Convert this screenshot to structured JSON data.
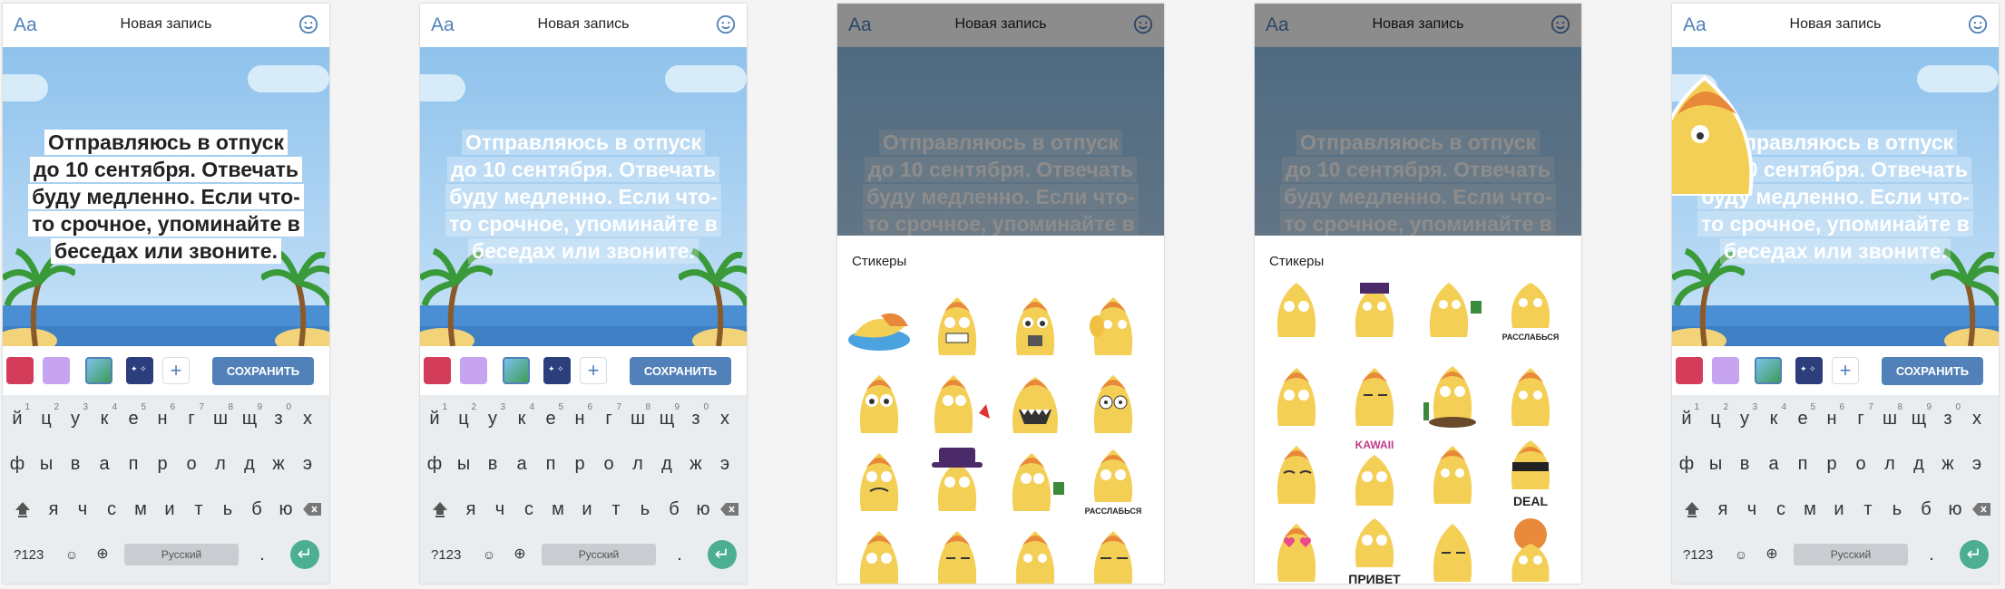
{
  "header": {
    "aa": "Aa",
    "title": "Новая запись"
  },
  "message": {
    "lines": [
      "Отправляюсь в отпуск",
      "до 10 сентября. Отвечать",
      "буду медленно. Если что-",
      "то срочное, упоминайте в",
      "беседах или звоните."
    ]
  },
  "toolbar": {
    "save_label": "СОХРАНИТЬ",
    "plus_label": "+"
  },
  "keyboard": {
    "row1": [
      "й",
      "ц",
      "у",
      "к",
      "е",
      "н",
      "г",
      "ш",
      "щ",
      "з",
      "х"
    ],
    "row1_hints": [
      "1",
      "2",
      "3",
      "4",
      "5",
      "6",
      "7",
      "8",
      "9",
      "0",
      ""
    ],
    "row2": [
      "ф",
      "ы",
      "в",
      "а",
      "п",
      "р",
      "о",
      "л",
      "д",
      "ж",
      "э"
    ],
    "row3": [
      "я",
      "ч",
      "с",
      "м",
      "и",
      "т",
      "ь",
      "б",
      "ю"
    ],
    "num_label": "?123",
    "space_label": "Русский",
    "period": "."
  },
  "stickers": {
    "title": "Стикеры",
    "captions": {
      "relax": "РАССЛАБЬСЯ",
      "kawaii": "KAWAII",
      "deal": "DEAL",
      "privet": "ПРИВЕТ"
    }
  },
  "colors": {
    "accent": "#5181b8",
    "enter": "#4caf92",
    "sky": "#8fc2ec"
  }
}
